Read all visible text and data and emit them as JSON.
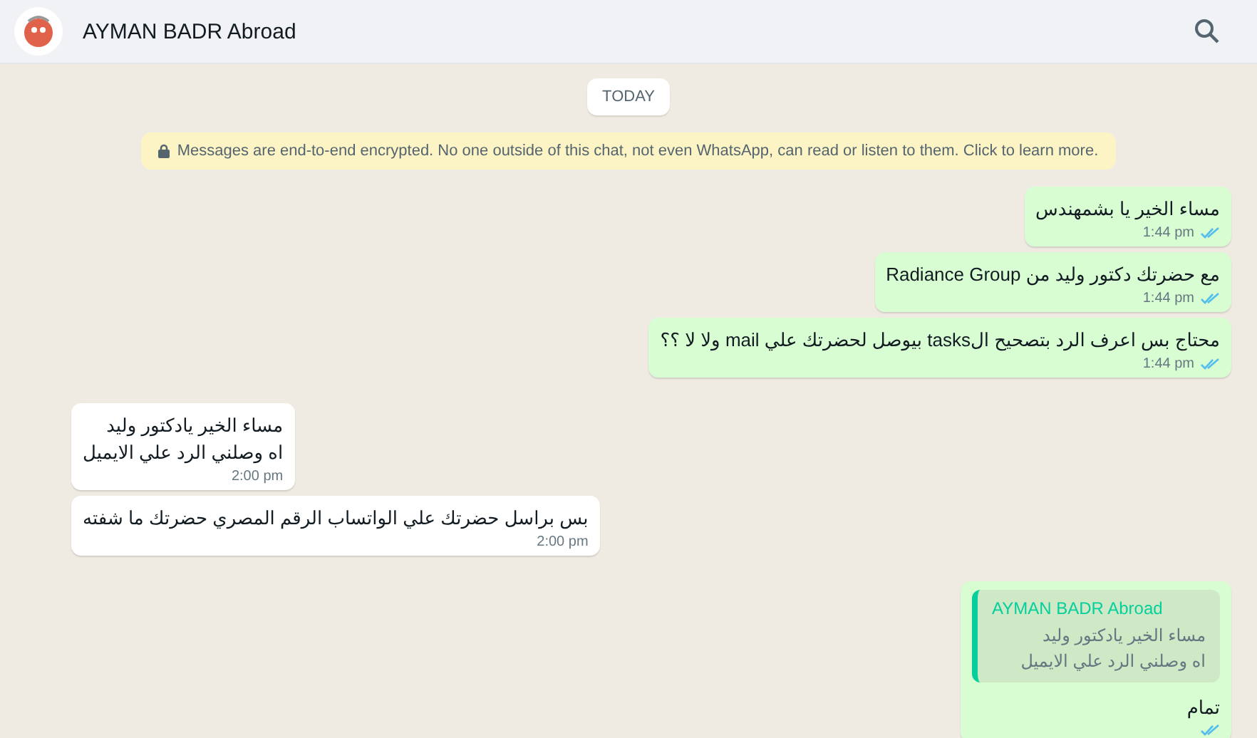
{
  "header": {
    "title": "AYMAN BADR Abroad"
  },
  "date_chip": "TODAY",
  "encryption_notice": "Messages are end-to-end encrypted. No one outside of this chat, not even WhatsApp, can read or listen to them. Click to learn more.",
  "messages": [
    {
      "kind": "outgoing",
      "text": "مساء الخير يا بشمهندس",
      "time": "1:44 pm",
      "read": true
    },
    {
      "kind": "outgoing",
      "text": "مع حضرتك دكتور وليد من Radiance Group",
      "time": "1:44 pm",
      "read": true
    },
    {
      "kind": "outgoing",
      "text": "محتاج بس اعرف الرد بتصحيح الtasks بيوصل لحضرتك علي mail ولا لا ؟؟",
      "time": "1:44 pm",
      "read": true
    },
    {
      "kind": "incoming",
      "text": "مساء الخير يادكتور وليد\nاه وصلني الرد علي الايميل",
      "time": "2:00 pm"
    },
    {
      "kind": "incoming",
      "text": "بس براسل حضرتك علي الواتساب الرقم المصري حضرتك ما شفته",
      "time": "2:00 pm"
    },
    {
      "kind": "outgoing",
      "quote": {
        "author": "AYMAN BADR Abroad",
        "text": "مساء الخير يادكتور وليد\nاه وصلني الرد علي الايميل"
      },
      "text": "تمام",
      "read": true
    }
  ]
}
